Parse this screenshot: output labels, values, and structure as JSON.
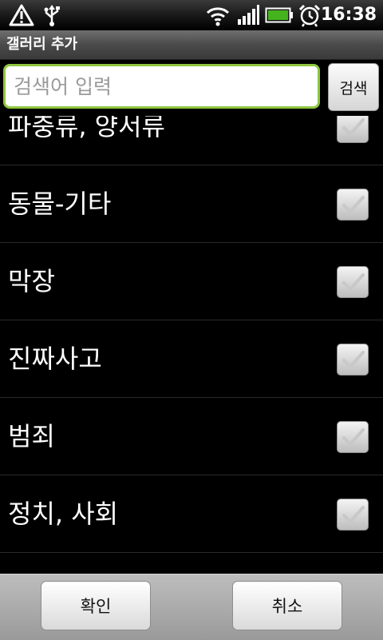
{
  "status_bar": {
    "time": "16:38",
    "icons": [
      "alert-icon",
      "usb-icon",
      "wifi-icon",
      "signal-icon",
      "battery-icon",
      "alarm-icon"
    ]
  },
  "title_bar": {
    "title": "갤러리 추가"
  },
  "search": {
    "placeholder": "검색어 입력",
    "value": "",
    "button_label": "검색"
  },
  "list": {
    "items": [
      {
        "label": "파충류, 양서류",
        "checked": true
      },
      {
        "label": "동물-기타",
        "checked": true
      },
      {
        "label": "막장",
        "checked": true
      },
      {
        "label": "진짜사고",
        "checked": true
      },
      {
        "label": "범죄",
        "checked": true
      },
      {
        "label": "정치, 사회",
        "checked": true
      }
    ]
  },
  "bottom_bar": {
    "confirm_label": "확인",
    "cancel_label": "취소"
  },
  "colors": {
    "search_focus_border": "#8ec63f",
    "background": "#000000",
    "check_mark": "#c8c8c8"
  }
}
